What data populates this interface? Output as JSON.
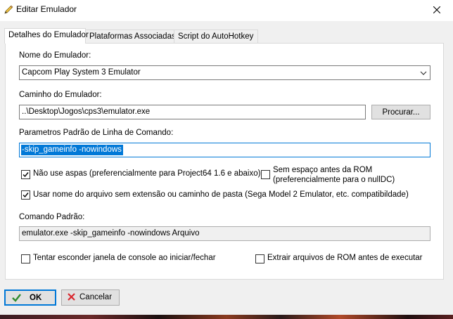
{
  "window": {
    "title": "Editar Emulador",
    "close_icon": "close-icon",
    "title_icon": "pencil-edit-icon"
  },
  "tabs": [
    {
      "label": "Detalhes do Emulador",
      "active": true
    },
    {
      "label": "Plataformas Associadas",
      "active": false
    },
    {
      "label": "Script do AutoHotkey",
      "active": false
    }
  ],
  "emulator_name": {
    "label": "Nome do Emulador:",
    "value": "Capcom Play System 3 Emulator"
  },
  "emulator_path": {
    "label": "Caminho do Emulador:",
    "value": "..\\Desktop\\Jogos\\cps3\\emulator.exe",
    "browse_label": "Procurar..."
  },
  "command_line": {
    "label": "Parametros Padrão de Linha de Comando:",
    "value": "-skip_gameinfo -nowindows"
  },
  "options": {
    "no_quotes": {
      "label": "Não use aspas (preferencialmente para Project64 1.6 e abaixo)",
      "checked": true
    },
    "no_space_before_rom": {
      "label_line1": "Sem espaço antes da ROM",
      "label_line2": "(preferencialmente para o nullDC)",
      "checked": false
    },
    "filename_only": {
      "label": "Usar nome do arquivo sem extensão ou caminho de pasta (Sega Model 2 Emulator, etc. compatibildade)",
      "checked": true
    },
    "hide_console": {
      "label": "Tentar esconder janela de console ao iniciar/fechar",
      "checked": false
    },
    "extract_rom": {
      "label": "Extrair arquivos de ROM antes de executar",
      "checked": false
    }
  },
  "default_command": {
    "label": "Comando Padrão:",
    "value": "emulator.exe -skip_gameinfo -nowindows Arquivo"
  },
  "buttons": {
    "ok_label": "OK",
    "cancel_label": "Cancelar",
    "ok_icon": "checkmark-icon",
    "cancel_icon": "red-x-icon"
  },
  "colors": {
    "accent": "#0078d7",
    "checkmark": "#2e8b2e",
    "cancel_x": "#d9282f"
  }
}
